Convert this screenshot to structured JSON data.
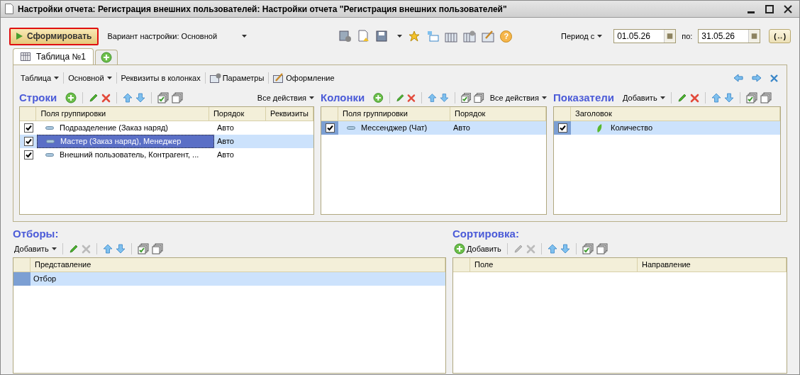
{
  "window": {
    "title": "Настройки отчета: Регистрация внешних пользователей: Настройки отчета \"Регистрация внешних пользователей\""
  },
  "toolbar": {
    "generate_button": "Сформировать",
    "variant": "Вариант настройки: Основной",
    "help_button": "?",
    "period_label": "Период с",
    "date_from": "01.05.26",
    "to_label": "по:",
    "date_to": "31.05.26",
    "period_button": "(↔)"
  },
  "tabs": [
    {
      "label": "Таблица №1",
      "selected": true
    }
  ],
  "tab_toolbar": [
    {
      "label": "Таблица",
      "kind": "menu"
    },
    {
      "label": "Основной",
      "kind": "menu"
    },
    {
      "label": "Реквизиты в колонках",
      "kind": "plain"
    },
    {
      "label": "Параметры",
      "kind": "params"
    },
    {
      "label": "Оформление",
      "kind": "design"
    }
  ],
  "panels": [
    {
      "title": "Строки",
      "kind": "grouping",
      "all_actions": "Все действия",
      "columns": [
        "Поля группировки",
        "Порядок",
        "Реквизиты"
      ],
      "rows": [
        {
          "cells": [
            "Подразделение (Заказ наряд)",
            "Авто",
            ""
          ],
          "checked": true,
          "selected": false
        },
        {
          "cells": [
            "Мастер (Заказ наряд), Менеджер",
            "Авто",
            ""
          ],
          "checked": true,
          "selected": true
        },
        {
          "cells": [
            "Внешний пользователь, Контрагент, ...",
            "Авто",
            ""
          ],
          "checked": true,
          "selected": false
        }
      ]
    },
    {
      "title": "Колонки",
      "kind": "grouping",
      "all_actions": "Все действия",
      "columns": [
        "Поля группировки",
        "Порядок"
      ],
      "rows": [
        {
          "cells": [
            "Мессенджер (Чат)",
            "Авто"
          ],
          "checked": true,
          "selected": true
        }
      ]
    },
    {
      "title": "Показатели",
      "kind": "indicator",
      "add_button": "Добавить",
      "columns": [
        "Заголовок"
      ],
      "rows": [
        {
          "cells": [
            "Количество"
          ],
          "checked": true,
          "selected": true
        }
      ]
    }
  ],
  "filters": {
    "title": "Отборы:",
    "add_button": "Добавить",
    "columns": [
      "Представление"
    ],
    "rows": [
      {
        "cells": [
          "Отбор"
        ],
        "selected": true
      }
    ]
  },
  "sorting": {
    "title": "Сортировка:",
    "add_button": "Добавить",
    "columns": [
      "Поле",
      "Направление"
    ]
  }
}
